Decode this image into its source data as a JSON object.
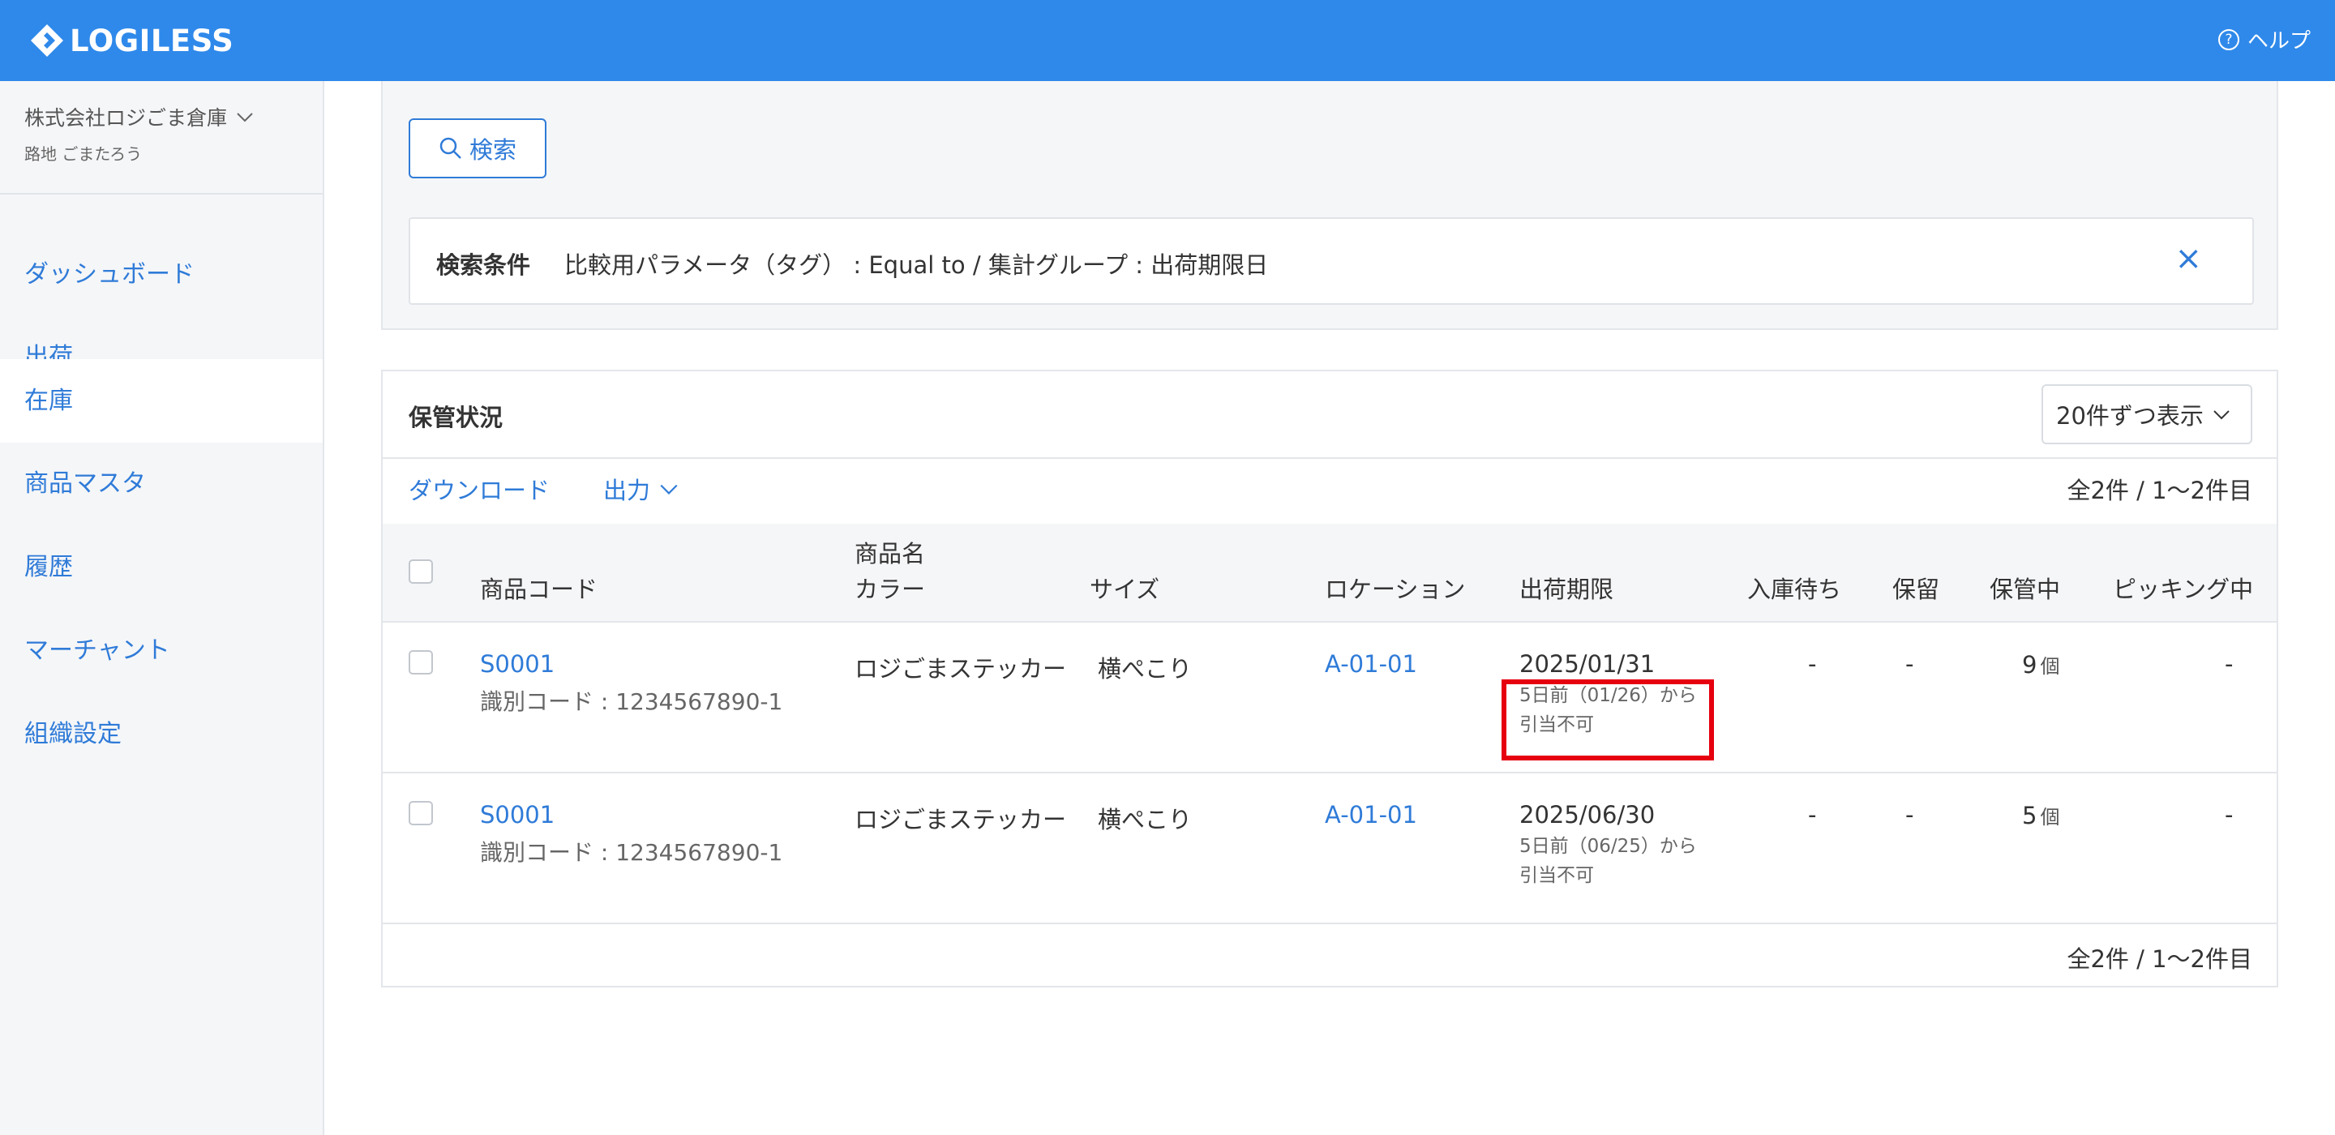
{
  "app": {
    "logo_text": "LOGILESS",
    "help_label": "ヘルプ"
  },
  "sidebar": {
    "org_name": "株式会社ロジごま倉庫",
    "user_name": "路地 ごまたろう",
    "items": [
      {
        "label": "ダッシュボード"
      },
      {
        "label": "出荷"
      },
      {
        "label": "在庫"
      },
      {
        "label": "商品マスタ"
      },
      {
        "label": "履歴"
      },
      {
        "label": "マーチャント"
      },
      {
        "label": "組織設定"
      }
    ],
    "active_item": "在庫"
  },
  "search": {
    "button_label": "検索",
    "condition_label": "検索条件",
    "condition_text": "比較用パラメータ（タグ） : Equal to / 集計グループ : 出荷期限日",
    "clear_icon": "×"
  },
  "table_panel": {
    "title": "保管状況",
    "per_page": "20件ずつ表示",
    "download_label": "ダウンロード",
    "export_label": "出力",
    "count_label": "全2件 / 1〜2件目",
    "headers": {
      "code": "商品コード",
      "name": "商品名",
      "color": "カラー",
      "size": "サイズ",
      "location": "ロケーション",
      "deadline": "出荷期限",
      "incoming": "入庫待ち",
      "hold": "保留",
      "stored": "保管中",
      "picking": "ピッキング中"
    },
    "rows": [
      {
        "code": "S0001",
        "id_code": "識別コード : 1234567890-1",
        "name": "ロジごまステッカー",
        "size": "横ぺこり",
        "location": "A-01-01",
        "deadline": "2025/01/31",
        "deadline_note_1": "5日前（01/26）から",
        "deadline_note_2": "引当不可",
        "incoming": "-",
        "hold": "-",
        "stored": "9",
        "stored_unit": "個",
        "picking": "-"
      },
      {
        "code": "S0001",
        "id_code": "識別コード : 1234567890-1",
        "name": "ロジごまステッカー",
        "size": "横ぺこり",
        "location": "A-01-01",
        "deadline": "2025/06/30",
        "deadline_note_1": "5日前（06/25）から",
        "deadline_note_2": "引当不可",
        "incoming": "-",
        "hold": "-",
        "stored": "5",
        "stored_unit": "個",
        "picking": "-"
      }
    ]
  },
  "colors": {
    "header_blue": "#2f89ea",
    "link_blue": "#2f7bd8",
    "highlight_red": "#e6000f"
  }
}
